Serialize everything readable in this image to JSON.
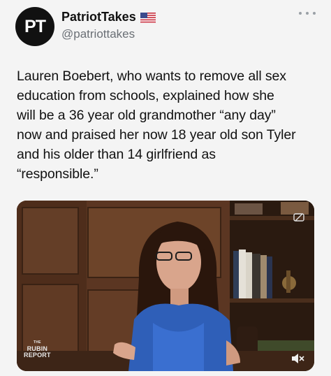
{
  "author": {
    "avatar_initials": "PT",
    "display_name": "PatriotTakes",
    "flag_icon": "us-flag-icon",
    "handle": "@patriottakes"
  },
  "tweet": {
    "text": "Lauren Boebert, who wants to remove all sex\neducation from schools, explained how she\nwill be a 36 year old grandmother “any day”\nnow and praised her now 18 year old son Tyler\nand his older than 14 girlfriend as\n“responsible.”"
  },
  "media": {
    "watermark_small": "THE",
    "watermark_line1": "RUBIN",
    "watermark_line2": "REPORT",
    "icons": [
      "gif-icon",
      "mute-icon"
    ]
  },
  "colors": {
    "background": "#f4f4f4",
    "text": "#111111",
    "handle": "#6a6f75",
    "avatar_bg": "#111111"
  }
}
